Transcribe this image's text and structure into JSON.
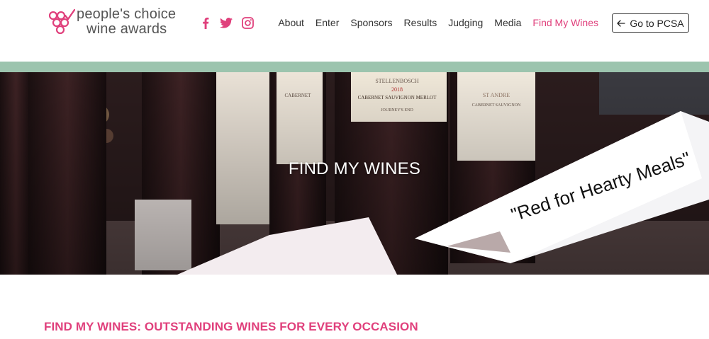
{
  "brand": {
    "line1": "people's choice",
    "line2": "wine awards",
    "accent_color": "#e0407c",
    "band_color": "#9cc4ae"
  },
  "social": [
    {
      "icon": "facebook-icon"
    },
    {
      "icon": "twitter-icon"
    },
    {
      "icon": "instagram-icon"
    }
  ],
  "nav": {
    "items": [
      "About",
      "Enter",
      "Sponsors",
      "Results",
      "Judging",
      "Media",
      "Find My Wines"
    ],
    "active": "Find My Wines",
    "cta_label": "Go to PCSA"
  },
  "hero": {
    "title": "FIND MY WINES",
    "labels": {
      "bottle_region": "STELLENBOSCH",
      "bottle_year": "2018",
      "bottle_varietal": "CABERNET SAUVIGNON MERLOT",
      "bottle_sub": "JOURNEY'S END",
      "bottle_left": "CABERNET",
      "bottle_right_name": "ST ANDRE",
      "bottle_right_varietal": "CABERNET SAUVIGNON",
      "tent_card": "\"Red for Hearty Meals\""
    }
  },
  "main": {
    "heading": "FIND MY WINES: OUTSTANDING WINES FOR EVERY OCCASION"
  }
}
